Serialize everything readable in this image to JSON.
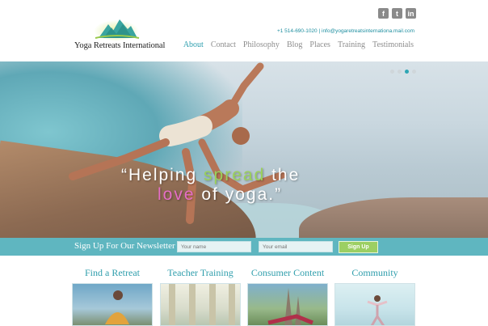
{
  "brand": {
    "name": "Yoga Retreats International"
  },
  "social": {
    "facebook": "f",
    "twitter": "t",
    "linkedin": "in"
  },
  "contact": {
    "phone": "+1 514-690-1020",
    "separator": "|",
    "email": "info@yogaretreatsinternationa.mail.com"
  },
  "nav": {
    "items": [
      "About",
      "Contact",
      "Philosophy",
      "Blog",
      "Places",
      "Training",
      "Testimonials"
    ],
    "active": "About"
  },
  "hero": {
    "quote_open": "“Helping ",
    "quote_green": "spread",
    "quote_end1": " the",
    "quote_pink": "love",
    "quote_end2": " of yoga.”",
    "slides": 4,
    "active_slide": 3
  },
  "newsletter": {
    "label": "Sign Up For Our Newsletter",
    "name_placeholder": "Your name",
    "email_placeholder": "Your email",
    "button": "Sign Up"
  },
  "cards": [
    {
      "title": "Find a Retreat",
      "image": "woman-meditating"
    },
    {
      "title": "Teacher Training",
      "image": "temple-columns"
    },
    {
      "title": "Consumer Content",
      "image": "yoga-by-cathedral"
    },
    {
      "title": "Community",
      "image": "yoga-pose-outdoors"
    }
  ],
  "colors": {
    "accent": "#2e9fae",
    "newsletter_bar": "#5fb6c0",
    "button": "#9ccf63",
    "green_text": "#9ad15a",
    "pink_text": "#e56ec6"
  }
}
